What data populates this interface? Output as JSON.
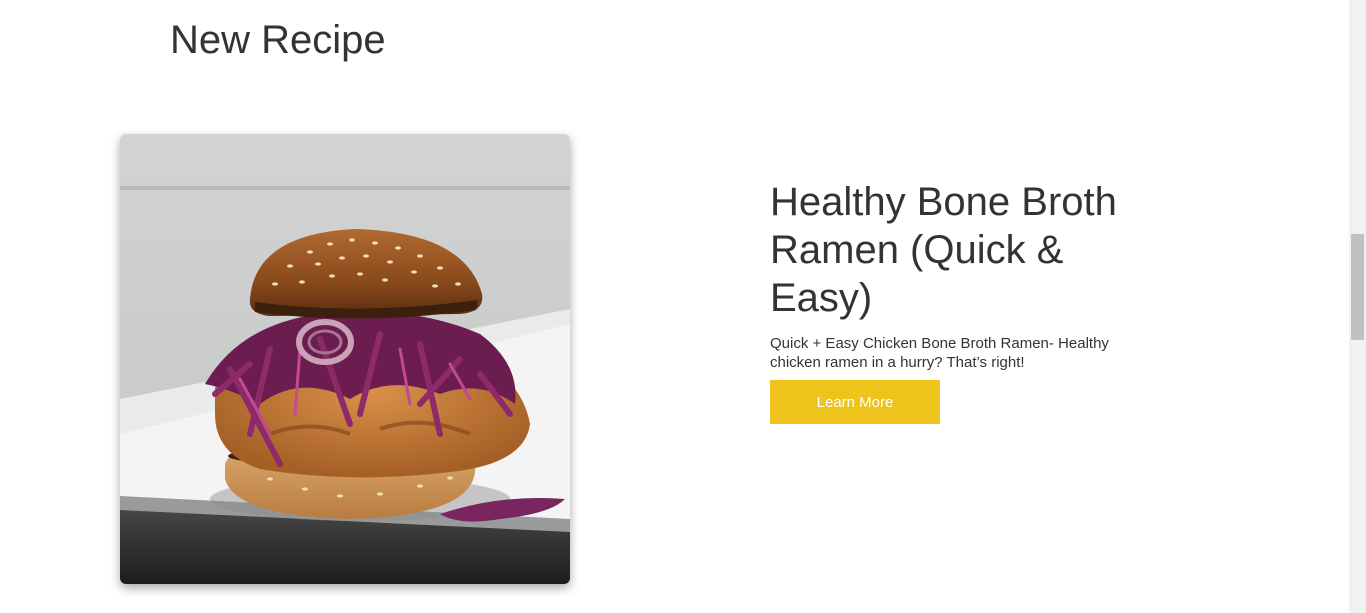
{
  "section": {
    "title": "New Recipe"
  },
  "recipe": {
    "image_alt": "Fried chicken sandwich with purple slaw on a sesame bun",
    "title": "Healthy Bone Broth Ramen (Quick & Easy)",
    "description": "Quick + Easy Chicken Bone Broth Ramen- Healthy chicken ramen in a hurry? That’s right!",
    "button_label": "Learn More",
    "button_color": "#eec31b"
  },
  "scrollbar": {
    "position_fraction": 0.38
  }
}
